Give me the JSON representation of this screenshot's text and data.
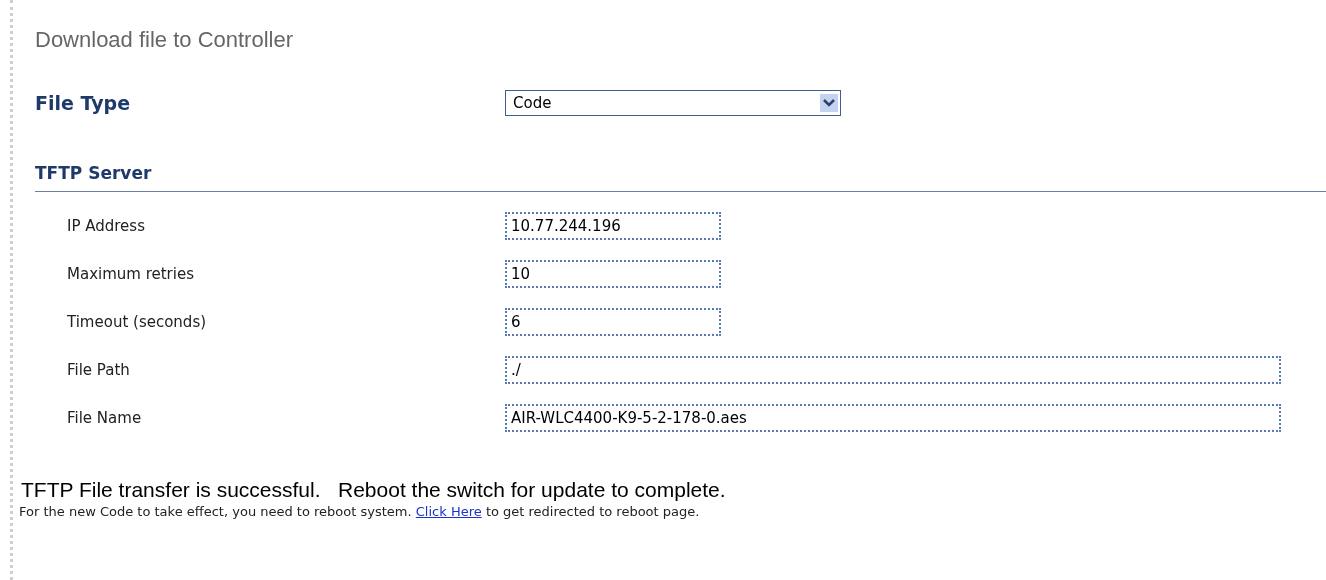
{
  "title": "Download file to Controller",
  "file_type": {
    "label": "File Type",
    "value": "Code"
  },
  "section": {
    "title": "TFTP Server"
  },
  "fields": [
    {
      "label": "IP Address",
      "value": "10.77.244.196",
      "kind": "short"
    },
    {
      "label": "Maximum retries",
      "value": "10",
      "kind": "short"
    },
    {
      "label": "Timeout (seconds)",
      "value": "6",
      "kind": "short"
    },
    {
      "label": "File Path",
      "value": "./",
      "kind": "long"
    },
    {
      "label": "File Name",
      "value": "AIR-WLC4400-K9-5-2-178-0.aes",
      "kind": "long"
    }
  ],
  "status": {
    "message": "TFTP File transfer is successful.   Reboot the switch for update to complete.",
    "note_before": "For the new Code to take effect, you need to reboot system.",
    "link": "Click Here",
    "note_after": "to get redirected to reboot page."
  }
}
